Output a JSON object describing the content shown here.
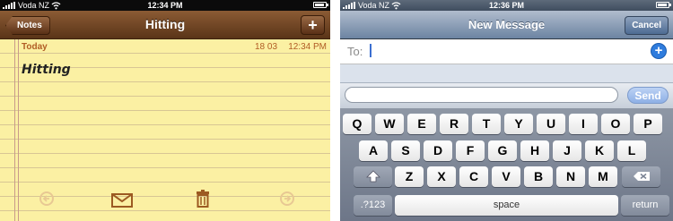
{
  "left_screen": {
    "status": {
      "carrier": "Voda NZ",
      "time": "12:34 PM"
    },
    "nav": {
      "back_label": "Notes",
      "title": "Hitting",
      "add_label": "+"
    },
    "note": {
      "day": "Today",
      "date": "18 03",
      "time": "12:34 PM",
      "text": "Hitting"
    },
    "toolbar_icons": [
      "previous-arrow-icon",
      "mail-icon",
      "trash-icon",
      "next-arrow-icon"
    ],
    "colors": {
      "paper": "#fbf0a3",
      "header": "#6b4223",
      "accent_text": "#b15d25"
    }
  },
  "right_screen": {
    "status": {
      "carrier": "Voda NZ",
      "time": "12:36 PM"
    },
    "nav": {
      "title": "New Message",
      "cancel_label": "Cancel"
    },
    "to_label": "To:",
    "add_contact_label": "+",
    "compose": {
      "send_label": "Send",
      "text": ""
    },
    "keyboard": {
      "row1": [
        "Q",
        "W",
        "E",
        "R",
        "T",
        "Y",
        "U",
        "I",
        "O",
        "P"
      ],
      "row2": [
        "A",
        "S",
        "D",
        "F",
        "G",
        "H",
        "J",
        "K",
        "L"
      ],
      "row3": [
        "Z",
        "X",
        "C",
        "V",
        "B",
        "N",
        "M"
      ],
      "numbers_label": ".?123",
      "space_label": "space",
      "return_label": "return"
    },
    "colors": {
      "nav": "#8ea0b8",
      "send": "#9ebbea",
      "keyboard_bg": "#7e8796"
    }
  }
}
